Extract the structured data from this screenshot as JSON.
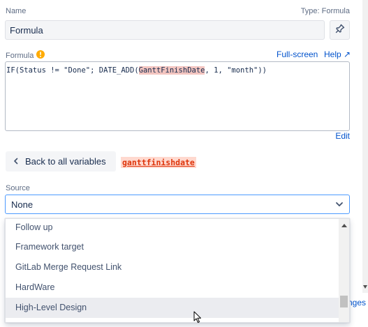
{
  "name_field": {
    "label": "Name",
    "type_label": "Type: Formula",
    "value": "Formula"
  },
  "formula": {
    "label": "Formula",
    "fullscreen_label": "Full-screen",
    "help_label": "Help ↗",
    "code_prefix": "IF(Status != \"Done\"; DATE_ADD(",
    "code_highlight": "GanttFinishDate",
    "code_suffix": ", 1, \"month\"))",
    "edit_label": "Edit"
  },
  "variables": {
    "back_label": "Back to all variables",
    "current_variable": "ganttfinishdate"
  },
  "source": {
    "label": "Source",
    "selected": "None",
    "options": [
      "Follow up",
      "Framework target",
      "GitLab Merge Request Link",
      "HardWare",
      "High-Level Design"
    ],
    "hovered_index": 4
  },
  "background": {
    "partial_link": "nges"
  },
  "colors": {
    "accent": "#0052cc",
    "warning": "#ffab00",
    "highlight_bg": "#f3c5c0",
    "variable_text": "#de350b",
    "focus_border": "#4c9aff"
  }
}
